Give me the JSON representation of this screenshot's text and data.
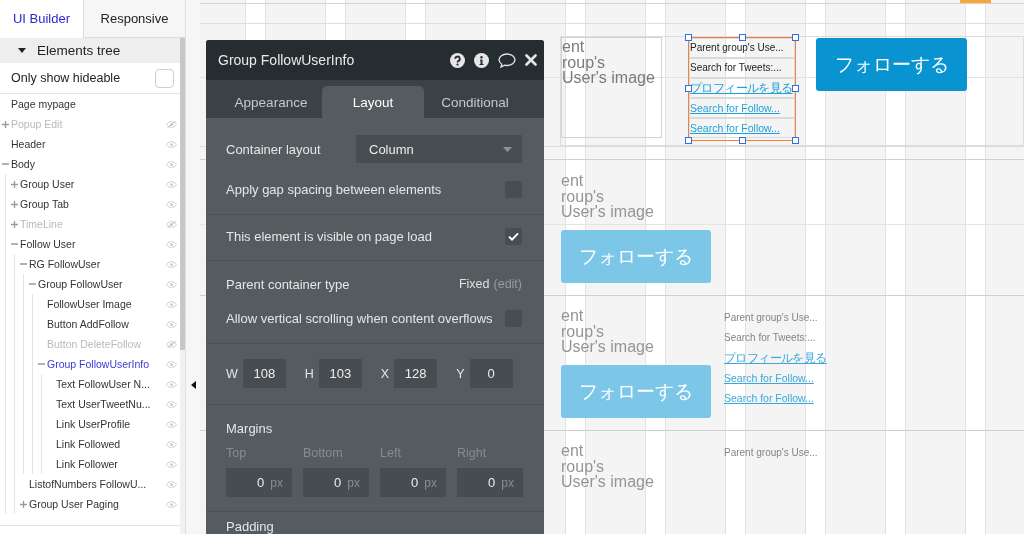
{
  "sidebar": {
    "tabs": [
      {
        "label": "UI Builder",
        "selected": true
      },
      {
        "label": "Responsive",
        "selected": false
      }
    ],
    "section": {
      "title": "Elements tree",
      "expanded": true
    },
    "filter": {
      "label": "Only show hideable",
      "checked": false
    },
    "tree": {
      "root": {
        "label": "Page mypage",
        "selected": false
      },
      "items": [
        {
          "label": "Popup Edit",
          "expanded": false,
          "hidden": true,
          "selected": false
        },
        {
          "label": "Header",
          "hidden": false,
          "selected": false
        },
        {
          "label": "Body",
          "expanded": true,
          "hidden": false,
          "selected": false,
          "children": [
            {
              "label": "Group User",
              "expanded": false,
              "hidden": false,
              "selected": false
            },
            {
              "label": "Group Tab",
              "expanded": false,
              "hidden": false,
              "selected": false
            },
            {
              "label": "TimeLine",
              "expanded": false,
              "hidden": true,
              "selected": false
            },
            {
              "label": "Follow User",
              "expanded": true,
              "hidden": false,
              "selected": false,
              "children": [
                {
                  "label": "RG FollowUser",
                  "expanded": true,
                  "hidden": false,
                  "selected": false,
                  "children": [
                    {
                      "label": "Group FollowUser",
                      "expanded": true,
                      "hidden": false,
                      "selected": false,
                      "children": [
                        {
                          "label": "FollowUser Image",
                          "hidden": false,
                          "selected": false
                        },
                        {
                          "label": "Button AddFollow",
                          "hidden": false,
                          "selected": false
                        },
                        {
                          "label": "Button DeleteFollow",
                          "hidden": true,
                          "selected": false
                        },
                        {
                          "label": "Group FollowUserInfo",
                          "expanded": true,
                          "hidden": false,
                          "selected": true,
                          "children": [
                            {
                              "label": "Text FollowUser N...",
                              "hidden": false,
                              "selected": false
                            },
                            {
                              "label": "Text UserTweetNu...",
                              "hidden": false,
                              "selected": false
                            },
                            {
                              "label": "Link UserProfile",
                              "hidden": false,
                              "selected": false
                            },
                            {
                              "label": "Link Followed",
                              "hidden": false,
                              "selected": false
                            },
                            {
                              "label": "Link Follower",
                              "hidden": false,
                              "selected": false
                            }
                          ]
                        }
                      ]
                    }
                  ]
                },
                {
                  "label": "ListofNumbers FollowU...",
                  "hidden": false,
                  "selected": false
                },
                {
                  "label": "Group User Paging",
                  "expanded": false,
                  "hidden": false,
                  "selected": false
                }
              ]
            }
          ]
        }
      ]
    }
  },
  "property_editor": {
    "title": "Group FollowUserInfo",
    "tabs": [
      {
        "label": "Appearance",
        "selected": false
      },
      {
        "label": "Layout",
        "selected": true
      },
      {
        "label": "Conditional",
        "selected": false
      }
    ],
    "sections": [
      {
        "rows": [
          {
            "kind": "dropdown",
            "label": "Container layout",
            "value": "Column"
          },
          {
            "kind": "checkbox",
            "label": "Apply gap spacing between elements",
            "checked": false
          }
        ]
      },
      {
        "rows": [
          {
            "kind": "checkbox",
            "label": "This element is visible on page load",
            "checked": true
          }
        ]
      },
      {
        "rows": [
          {
            "kind": "setting",
            "label": "Parent container type",
            "value": "Fixed",
            "action": "(edit)"
          },
          {
            "kind": "checkbox",
            "label": "Allow vertical scrolling when content overflows",
            "checked": false
          }
        ]
      },
      {
        "rows": [
          {
            "kind": "number_fields",
            "fields": [
              {
                "label": "W",
                "value": "108"
              },
              {
                "label": "H",
                "value": "103"
              },
              {
                "label": "X",
                "value": "128"
              },
              {
                "label": "Y",
                "value": "0"
              }
            ]
          }
        ]
      },
      {
        "rows": [
          {
            "kind": "heading",
            "label": "Margins"
          },
          {
            "kind": "unit_fields",
            "fields": [
              {
                "label": "Top",
                "value": "0",
                "unit": "px"
              },
              {
                "label": "Bottom",
                "value": "0",
                "unit": "px"
              },
              {
                "label": "Left",
                "value": "0",
                "unit": "px"
              },
              {
                "label": "Right",
                "value": "0",
                "unit": "px"
              }
            ]
          }
        ]
      },
      {
        "rows": [
          {
            "kind": "heading",
            "label": "Padding"
          }
        ]
      }
    ]
  },
  "canvas": {
    "cells": [
      {
        "faded": false,
        "selected": true,
        "image_text": "ent\nroup's\nUser's image",
        "info": [
          {
            "kind": "text",
            "text": "Parent group's Use..."
          },
          {
            "kind": "text",
            "text": "Search for Tweets:..."
          },
          {
            "kind": "link",
            "text": "プロフィールを見る"
          },
          {
            "kind": "link",
            "text": "Search for Follow..."
          },
          {
            "kind": "link",
            "text": "Search for Follow..."
          }
        ],
        "button": "フォローする"
      },
      {
        "faded": true,
        "selected": false,
        "image_text": "ent\nroup's\nUser's image",
        "button": "フォローする"
      },
      {
        "faded": true,
        "selected": false,
        "image_text": "ent\nroup's\nUser's image",
        "info": [
          {
            "kind": "text",
            "text": "Parent group's Use..."
          },
          {
            "kind": "text",
            "text": "Search for Tweets:..."
          },
          {
            "kind": "link",
            "text": "プロフィールを見る"
          },
          {
            "kind": "link",
            "text": "Search for Follow..."
          },
          {
            "kind": "link",
            "text": "Search for Follow..."
          }
        ],
        "button": "フォローする"
      },
      {
        "faded": true,
        "selected": false,
        "image_text": "ent\nroup's\nUser's image",
        "info": [
          {
            "kind": "text",
            "text": "Parent group's Use..."
          }
        ]
      }
    ]
  }
}
